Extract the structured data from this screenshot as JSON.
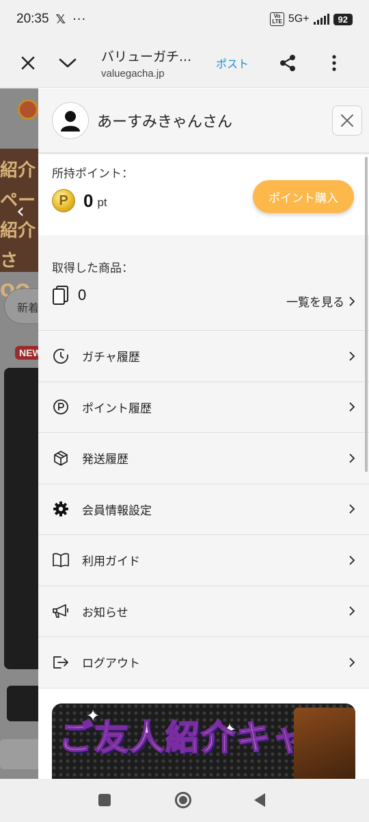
{
  "status_bar": {
    "time": "20:35",
    "x_logo": "𝕏",
    "more": "···",
    "volte": "Vo LTE",
    "network": "5G+",
    "battery": "92"
  },
  "browser": {
    "title": "バリューガチ...",
    "url": "valuegacha.jp",
    "post_label": "ポスト"
  },
  "background_page": {
    "banner_text": "紹介 ペー 紹介さ OO",
    "pill_label": "新着",
    "new_badge": "NEW"
  },
  "drawer": {
    "username": "あーすみきゃんさん",
    "points": {
      "label": "所持ポイント：",
      "coin_symbol": "P",
      "value": "0",
      "unit": "pt",
      "buy_button": "ポイント購入",
      "buy_button_color": "#fdb84b"
    },
    "items": {
      "label": "取得した商品：",
      "value": "0",
      "view_all": "一覧を見る"
    },
    "menu": [
      {
        "label": "ガチャ履歴",
        "icon": "clock-icon"
      },
      {
        "label": "ポイント履歴",
        "icon": "point-p-icon"
      },
      {
        "label": "発送履歴",
        "icon": "box-icon"
      },
      {
        "label": "会員情報設定",
        "icon": "gear-icon"
      },
      {
        "label": "利用ガイド",
        "icon": "book-icon"
      },
      {
        "label": "お知らせ",
        "icon": "megaphone-icon"
      },
      {
        "label": "ログアウト",
        "icon": "logout-icon"
      }
    ],
    "promo_text": "ご友人紹介キャンペーン!"
  }
}
